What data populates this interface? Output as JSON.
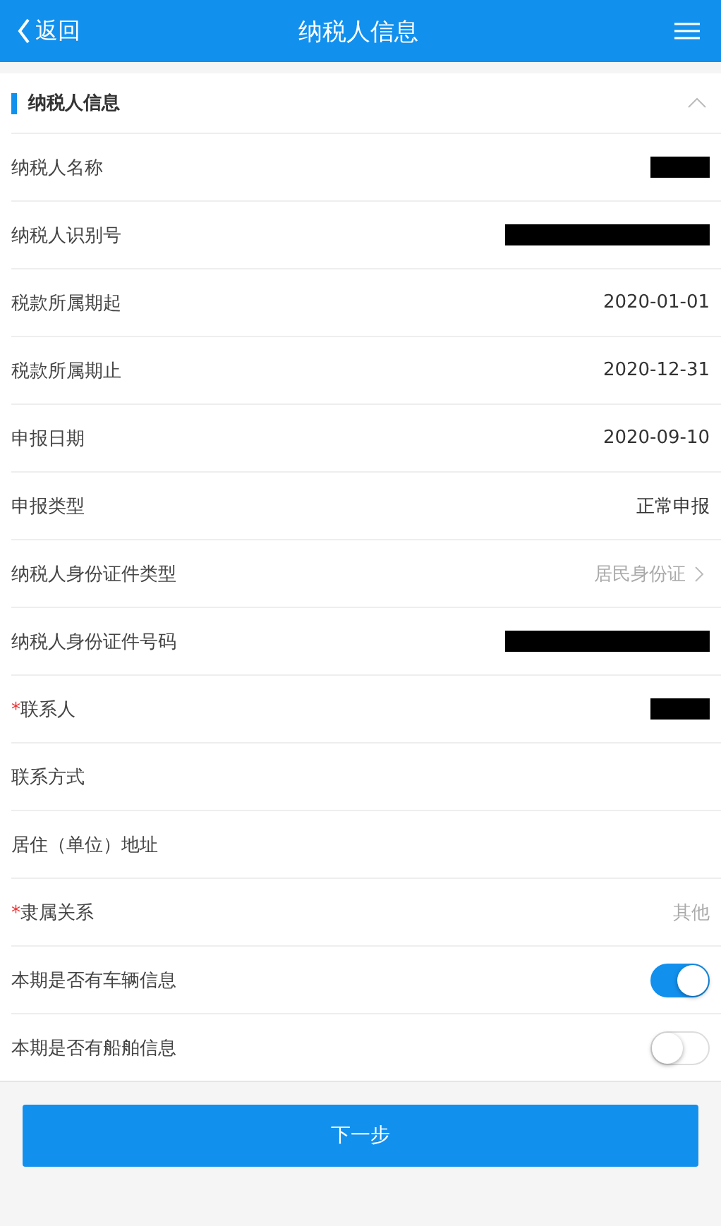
{
  "header": {
    "back_label": "返回",
    "title": "纳税人信息"
  },
  "section": {
    "title": "纳税人信息",
    "expanded": true
  },
  "rows": [
    {
      "kind": "redacted",
      "label": "纳税人名称",
      "required": false
    },
    {
      "kind": "redactedwide",
      "label": "纳税人识别号",
      "required": false
    },
    {
      "kind": "text",
      "label": "税款所属期起",
      "required": false,
      "value": "2020-01-01",
      "muted": false
    },
    {
      "kind": "text",
      "label": "税款所属期止",
      "required": false,
      "value": "2020-12-31",
      "muted": false
    },
    {
      "kind": "text",
      "label": "申报日期",
      "required": false,
      "value": "2020-09-10",
      "muted": false
    },
    {
      "kind": "text",
      "label": "申报类型",
      "required": false,
      "value": "正常申报",
      "muted": false
    },
    {
      "kind": "select",
      "label": "纳税人身份证件类型",
      "required": false,
      "value": "居民身份证",
      "muted": true
    },
    {
      "kind": "redactedwide",
      "label": "纳税人身份证件号码",
      "required": false
    },
    {
      "kind": "redacted",
      "label": "联系人",
      "required": true
    },
    {
      "kind": "empty",
      "label": "联系方式",
      "required": false
    },
    {
      "kind": "empty",
      "label": "居住（单位）地址",
      "required": false
    },
    {
      "kind": "text",
      "label": "隶属关系",
      "required": true,
      "value": "其他",
      "muted": true
    },
    {
      "kind": "toggle",
      "label": "本期是否有车辆信息",
      "required": false,
      "on": true
    },
    {
      "kind": "toggle",
      "label": "本期是否有船舶信息",
      "required": false,
      "on": false
    }
  ],
  "required_mark": "*",
  "next_button": "下一步"
}
